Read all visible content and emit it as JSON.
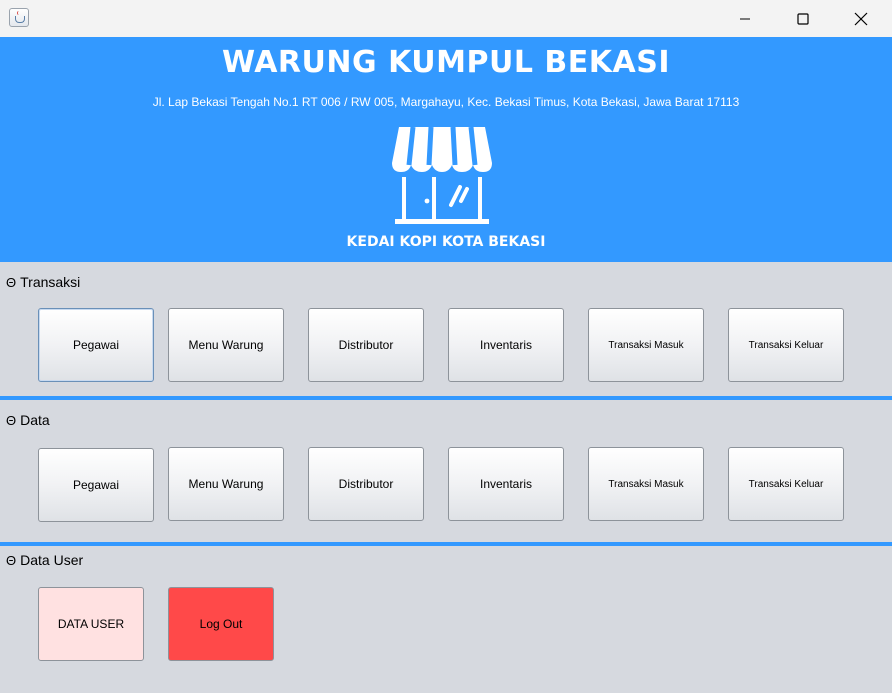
{
  "window": {
    "controls": {
      "minimize": "minimize",
      "maximize": "maximize",
      "close": "close"
    }
  },
  "header": {
    "title": "WARUNG KUMPUL BEKASI",
    "address": "Jl. Lap Bekasi Tengah No.1 RT 006 / RW 005,  Margahayu, Kec. Bekasi Timus, Kota Bekasi, Jawa Barat 17113",
    "subtitle": "KEDAI KOPI KOTA BEKASI",
    "icon": "storefront-icon"
  },
  "sections": {
    "transaksi": {
      "label": "Transaksi",
      "buttons": [
        "Pegawai",
        "Menu Warung",
        "Distributor",
        "Inventaris",
        "Transaksi Masuk",
        "Transaksi Keluar"
      ]
    },
    "data": {
      "label": "Data",
      "buttons": [
        "Pegawai",
        "Menu Warung",
        "Distributor",
        "Inventaris",
        "Transaksi Masuk",
        "Transaksi Keluar"
      ]
    },
    "data_user": {
      "label": "Data User",
      "buttons": [
        "DATA USER",
        "Log Out"
      ]
    }
  },
  "colors": {
    "accent": "#3399ff",
    "background": "#d6d9df",
    "data_user_button": "#ffe1e1",
    "logout_button": "#ff4949"
  }
}
